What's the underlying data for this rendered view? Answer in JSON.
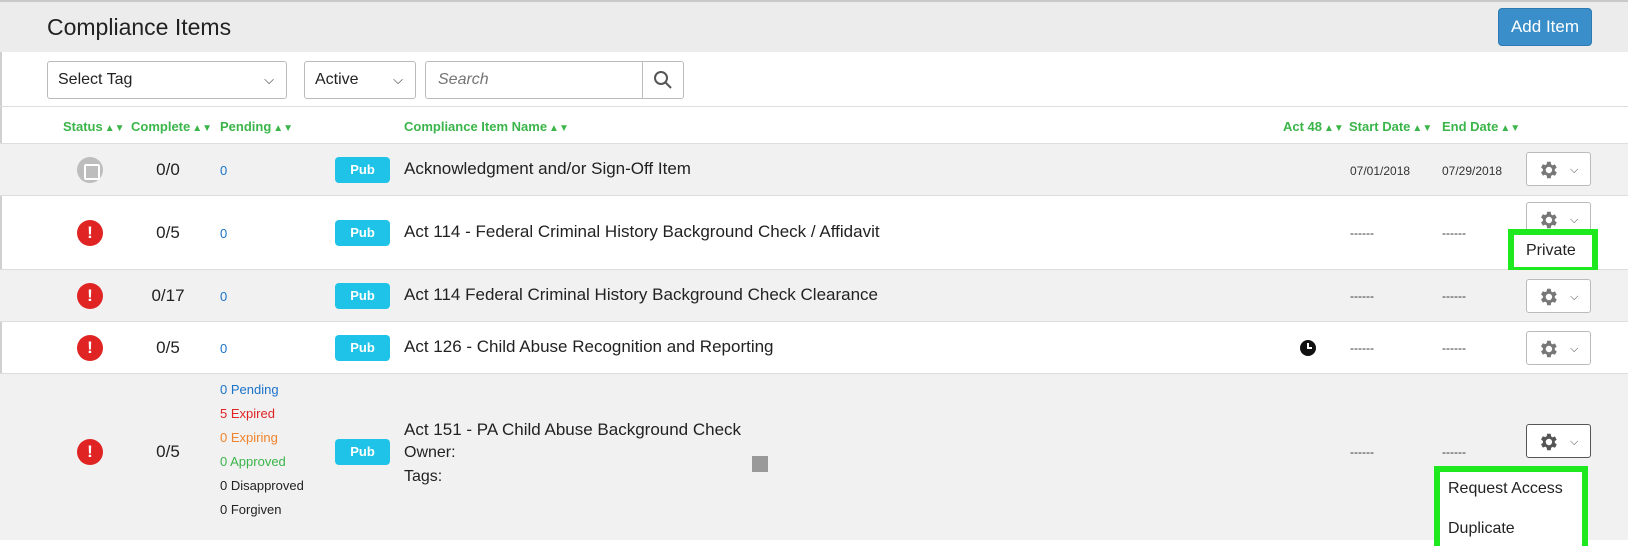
{
  "header": {
    "title": "Compliance Items",
    "add_button": "Add Item"
  },
  "filters": {
    "tag_select": "Select Tag",
    "status_select": "Active",
    "search_placeholder": "Search"
  },
  "columns": {
    "status": "Status",
    "complete": "Complete",
    "pending": "Pending",
    "name": "Compliance Item Name",
    "act48": "Act 48",
    "start": "Start Date",
    "end": "End Date"
  },
  "rows": [
    {
      "status": "inactive",
      "complete": "0/0",
      "pending": "0",
      "badge": "Pub",
      "name": "Acknowledgment and/or Sign-Off Item",
      "start": "07/01/2018",
      "end": "07/29/2018"
    },
    {
      "status": "error",
      "status_glyph": "!",
      "complete": "0/5",
      "pending": "0",
      "badge": "Pub",
      "name": "Act 114 - Federal Criminal History Background Check / Affidavit",
      "start": "------",
      "end": "------"
    },
    {
      "status": "error",
      "status_glyph": "!",
      "complete": "0/17",
      "pending": "0",
      "badge": "Pub",
      "name": "Act 114 Federal Criminal History Background Check Clearance",
      "start": "------",
      "end": "------"
    },
    {
      "status": "error",
      "status_glyph": "!",
      "complete": "0/5",
      "pending": "0",
      "badge": "Pub",
      "name": "Act 126 - Child Abuse Recognition and Reporting",
      "act48_icon": "clock-icon",
      "start": "------",
      "end": "------"
    },
    {
      "status": "error",
      "status_glyph": "!",
      "complete": "0/5",
      "badge": "Pub",
      "name": "Act 151 - PA Child Abuse Background Check",
      "owner_label": "Owner:",
      "tags_label": "Tags:",
      "start": "------",
      "end": "------",
      "stats": {
        "pending": "0 Pending",
        "expired": "5 Expired",
        "expiring": "0 Expiring",
        "approved": "0 Approved",
        "disapproved": "0 Disapproved",
        "forgiven": "0 Forgiven"
      }
    }
  ],
  "popups": {
    "private_label": "Private",
    "menu": [
      "Request Access",
      "Duplicate"
    ]
  },
  "colors": {
    "accent_green": "#3bb54a",
    "link_blue": "#1a73c9",
    "error_red": "#e02424",
    "expiring_orange": "#f0832b",
    "badge_cyan": "#1fc3e8",
    "highlight_green": "#1ee81e",
    "button_blue": "#3a8ec9"
  }
}
